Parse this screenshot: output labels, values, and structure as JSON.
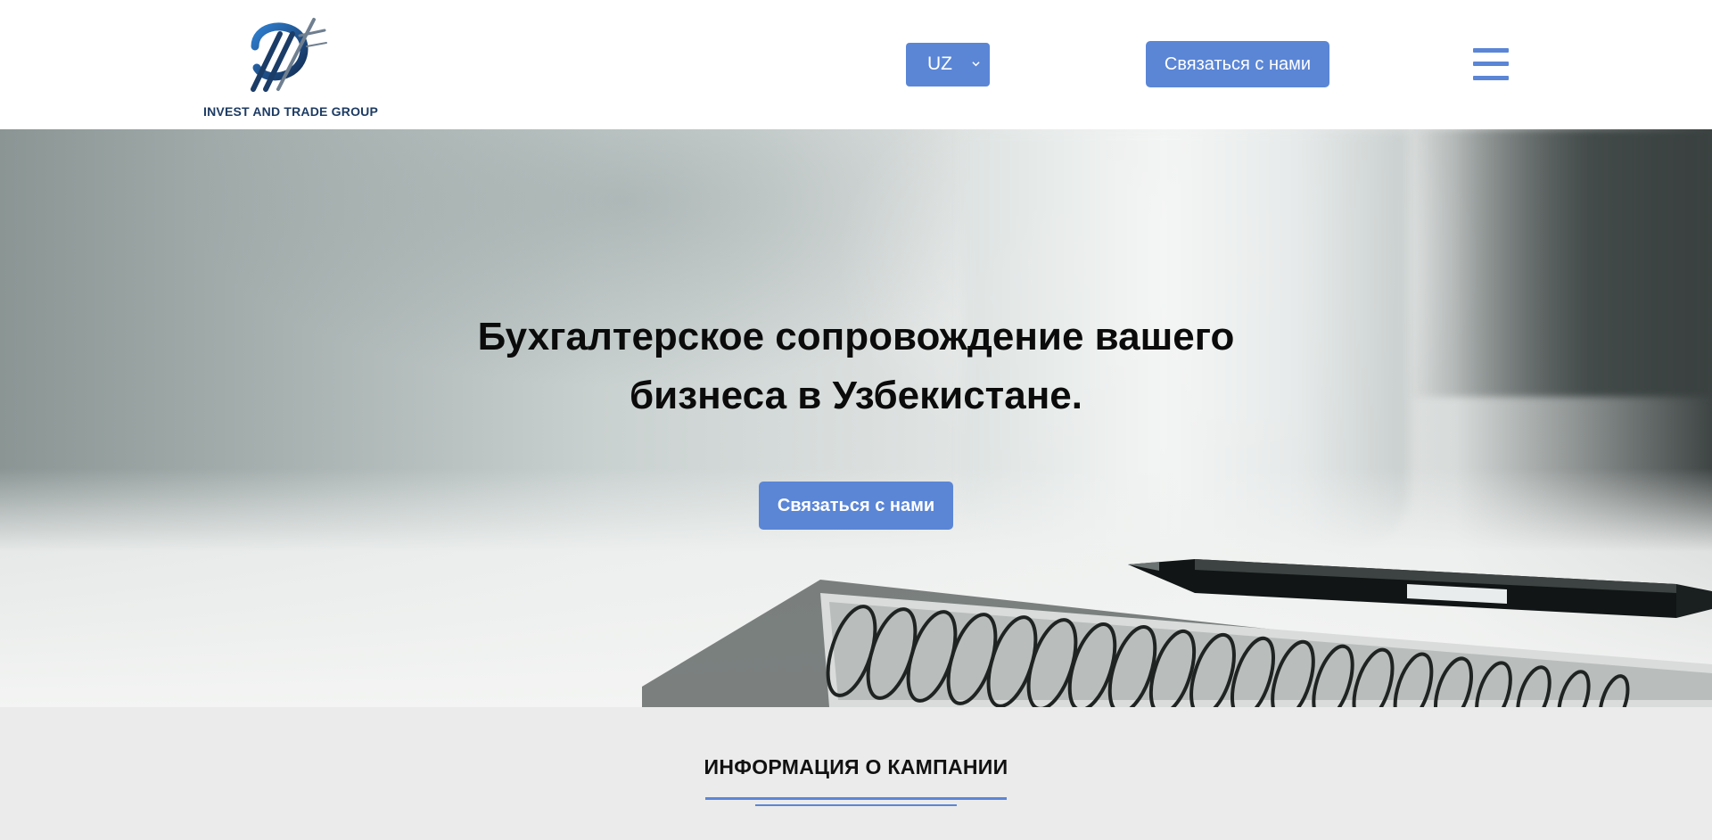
{
  "header": {
    "logo_text": "INVEST AND TRADE GROUP",
    "language": {
      "selected": "UZ"
    },
    "contact_button_label": "Связаться с нами",
    "menu_icon": "hamburger-menu-icon"
  },
  "hero": {
    "title": "Бухгалтерское сопровождение вашего бизнеса в Узбекистане.",
    "contact_button_label": "Связаться с нами"
  },
  "info_section": {
    "title": "ИНФОРМАЦИЯ О КАМПАНИИ"
  },
  "colors": {
    "accent": "#5b86d6",
    "brand_dark": "#1d3b63",
    "section_bg": "#ebebeb"
  }
}
